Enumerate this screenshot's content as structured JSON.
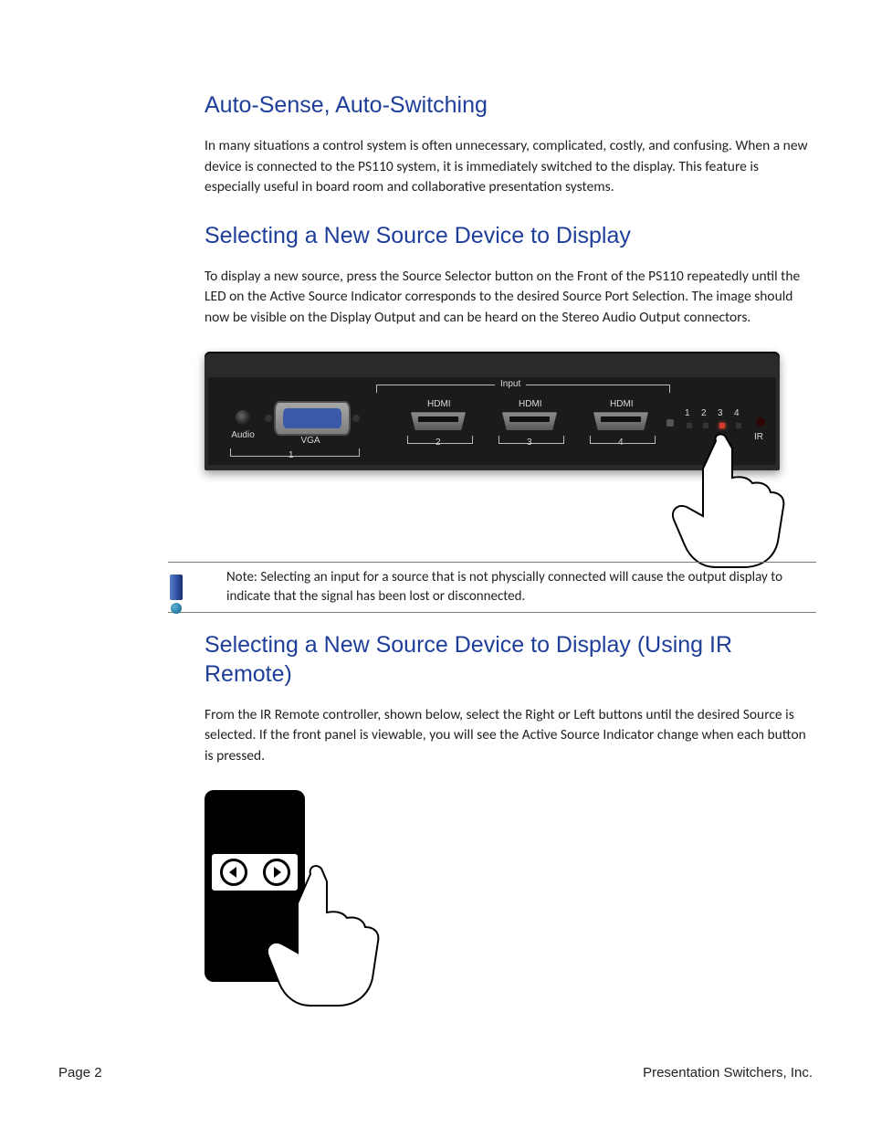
{
  "sections": {
    "s1": {
      "heading": "Auto-Sense, Auto-Switching",
      "body": "In many situations a control system is often unnecessary, complicated, costly, and confusing. When a new device is connected to the PS110 system, it is immediately switched to the display. This feature is especially useful in board room and collaborative presentation systems."
    },
    "s2": {
      "heading": "Selecting a New Source Device to Display",
      "body": "To display a new source, press the Source Selector button on the Front of the PS110 repeatedly until the LED on the Active Source Indicator corresponds to the desired Source Port Selection. The image should now be visible on the Display Output and can be heard on the Stereo Audio Output connectors."
    },
    "s3": {
      "heading": "Selecting a New Source Device to Display (Using IR Remote)",
      "body": "From the IR Remote controller, shown below, select the Right or Left buttons until the desired Source is selected. If the front panel is viewable, you will see the Active Source Indicator change when each button is pressed."
    }
  },
  "device": {
    "group_label": "Input",
    "audio_label": "Audio",
    "vga_label": "VGA",
    "hdmi_label": "HDMI",
    "ir_label": "IR",
    "port_numbers": {
      "p1": "1",
      "p2": "2",
      "p3": "3",
      "p4": "4"
    },
    "led_numbers": {
      "l1": "1",
      "l2": "2",
      "l3": "3",
      "l4": "4"
    },
    "active_led": 3
  },
  "note": {
    "text": "Note: Selecting an input for a source that is not physcially connected will cause the output display to indicate that the signal has been lost or disconnected."
  },
  "footer": {
    "page": "Page 2",
    "company": "Presentation Switchers, Inc."
  }
}
